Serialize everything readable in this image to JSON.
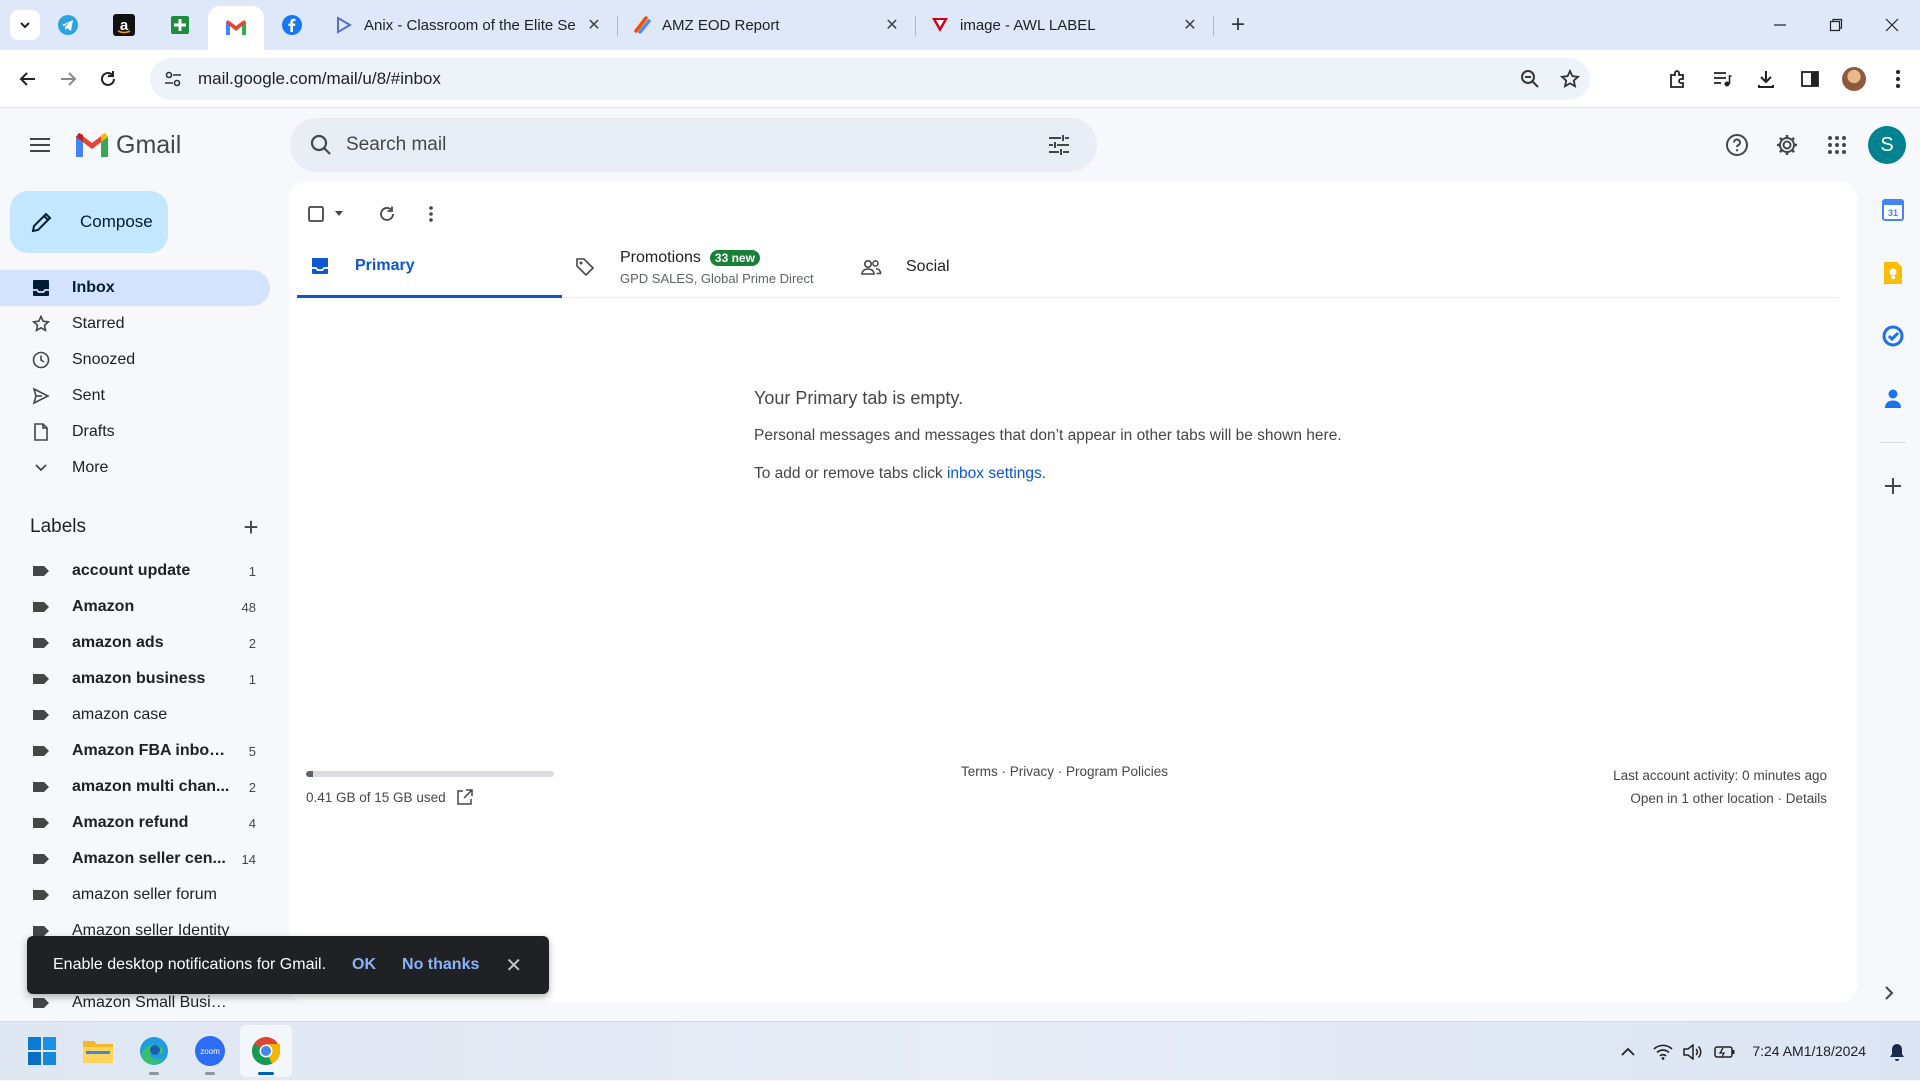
{
  "browser": {
    "tabs": [
      {
        "title": "Anix - Classroom of the Elite Se",
        "favicon": "anix-play-icon"
      },
      {
        "title": "AMZ EOD Report",
        "favicon": "zapier-icon"
      },
      {
        "title": "image - AWL LABEL",
        "favicon": "awl-logo-icon"
      }
    ],
    "pinned": [
      "telegram-icon",
      "amazon-icon",
      "google-sheets-icon",
      "gmail-icon",
      "facebook-icon"
    ],
    "url": "mail.google.com/mail/u/8/#inbox",
    "close_glyph": "✕",
    "new_tab_glyph": "+"
  },
  "gmail": {
    "logo_text": "Gmail",
    "search_placeholder": "Search mail",
    "avatar_letter": "S",
    "compose_label": "Compose",
    "nav": [
      {
        "label": "Inbox",
        "icon": "inbox-icon",
        "active": true
      },
      {
        "label": "Starred",
        "icon": "star-icon"
      },
      {
        "label": "Snoozed",
        "icon": "clock-icon"
      },
      {
        "label": "Sent",
        "icon": "send-icon"
      },
      {
        "label": "Drafts",
        "icon": "draft-icon"
      },
      {
        "label": "More",
        "icon": "chevron-down-icon"
      }
    ],
    "labels_title": "Labels",
    "labels_add": "+",
    "labels": [
      {
        "name": "account update",
        "count": "1",
        "bold": true
      },
      {
        "name": "Amazon",
        "count": "48",
        "bold": true
      },
      {
        "name": "amazon ads",
        "count": "2",
        "bold": true
      },
      {
        "name": "amazon business",
        "count": "1",
        "bold": true
      },
      {
        "name": "amazon case",
        "count": "",
        "bold": false
      },
      {
        "name": "Amazon FBA inbou...",
        "count": "5",
        "bold": true
      },
      {
        "name": "amazon multi chan...",
        "count": "2",
        "bold": true
      },
      {
        "name": "Amazon refund",
        "count": "4",
        "bold": true
      },
      {
        "name": "Amazon seller cen...",
        "count": "14",
        "bold": true
      },
      {
        "name": "amazon seller forum",
        "count": "",
        "bold": false
      },
      {
        "name": "Amazon seller Identity",
        "count": "",
        "bold": false
      },
      {
        "name": "",
        "count": "",
        "bold": false
      },
      {
        "name": "Amazon Small Business",
        "count": "",
        "bold": false
      }
    ],
    "tabs": {
      "primary": "Primary",
      "promotions": "Promotions",
      "promotions_badge": "33 new",
      "promotions_sub": "GPD SALES, Global Prime Direct",
      "social": "Social"
    },
    "empty": {
      "title": "Your Primary tab is empty.",
      "line1": "Personal messages and messages that don’t appear in other tabs will be shown here.",
      "line2_prefix": "To add or remove tabs click ",
      "line2_link": "inbox settings",
      "line2_suffix": "."
    },
    "storage": {
      "text": "0.41 GB of 15 GB used",
      "used_fraction": 0.027
    },
    "footer": {
      "terms": "Terms",
      "privacy": "Privacy",
      "policies": "Program Policies",
      "sep": " · "
    },
    "activity": {
      "line1": "Last account activity: 0 minutes ago",
      "line2_prefix": "Open in 1 other location · ",
      "details": "Details"
    },
    "side_panel": [
      "google-calendar-icon",
      "google-keep-icon",
      "google-tasks-icon",
      "google-contacts-icon",
      "plus-icon"
    ],
    "calendar_day": "31",
    "snackbar": {
      "text": "Enable desktop notifications for Gmail.",
      "ok": "OK",
      "no": "No thanks",
      "close": "✕"
    }
  },
  "taskbar": {
    "apps": [
      "windows-start-icon",
      "file-explorer-icon",
      "edge-icon",
      "zoom-icon",
      "chrome-icon"
    ],
    "zoom_text": "zoom",
    "time": "7:24 AM",
    "date": "1/18/2024"
  },
  "colors": {
    "accent": "#0b57d0",
    "compose": "#c2e7ff",
    "active_nav": "#d3e3fd",
    "badge": "#188038"
  }
}
